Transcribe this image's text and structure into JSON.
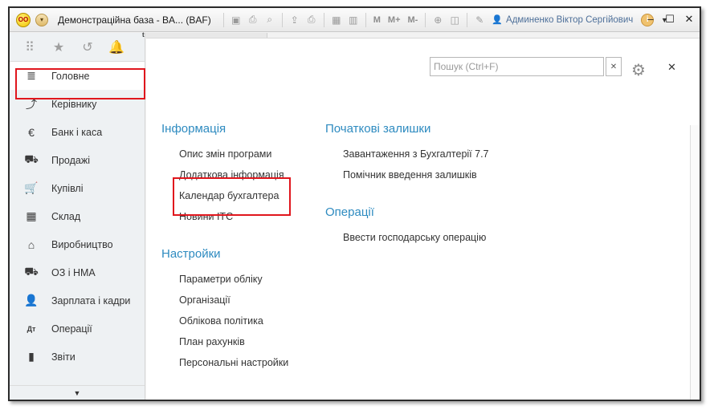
{
  "window": {
    "title": "Демонстраційна база - BA... (BAF)",
    "logo_text": "OO",
    "user_name": "Админенко Віктор Сергійович",
    "toolbar_text_buttons": [
      "M",
      "M+",
      "M-"
    ]
  },
  "sidebar": {
    "top_icons": [
      "apps-grid-icon",
      "star-icon",
      "history-icon",
      "bell-icon"
    ],
    "items": [
      {
        "label": "Головне",
        "icon": "≣"
      },
      {
        "label": "Керівнику",
        "icon": "⤴"
      },
      {
        "label": "Банк і каса",
        "icon": "€"
      },
      {
        "label": "Продажі",
        "icon": "⛟"
      },
      {
        "label": "Купівлі",
        "icon": "🛒"
      },
      {
        "label": "Склад",
        "icon": "▦"
      },
      {
        "label": "Виробництво",
        "icon": "⌂"
      },
      {
        "label": "ОЗ і НМА",
        "icon": "⛟"
      },
      {
        "label": "Зарплата і кадри",
        "icon": "👤"
      },
      {
        "label": "Операції",
        "icon": "Дт"
      },
      {
        "label": "Звіти",
        "icon": "▮"
      }
    ]
  },
  "tab": {
    "label": "t"
  },
  "search": {
    "placeholder": "Пошук (Ctrl+F)"
  },
  "sections": {
    "info": {
      "title": "Інформація",
      "links": [
        "Опис змін програми",
        "Додаткова інформація",
        "Календар бухгалтера",
        "Новини ІТС"
      ]
    },
    "settings": {
      "title": "Настройки",
      "links": [
        "Параметри обліку",
        "Організації",
        "Облікова політика",
        "План рахунків",
        "Персональні настройки"
      ]
    },
    "balances": {
      "title": "Початкові залишки",
      "links": [
        "Завантаження з Бухгалтерії 7.7",
        "Помічник введення залишків"
      ]
    },
    "operations": {
      "title": "Операції",
      "links": [
        "Ввести господарську операцію"
      ]
    }
  },
  "colors": {
    "accent": "#2e8bc0",
    "highlight": "#e0161d"
  }
}
